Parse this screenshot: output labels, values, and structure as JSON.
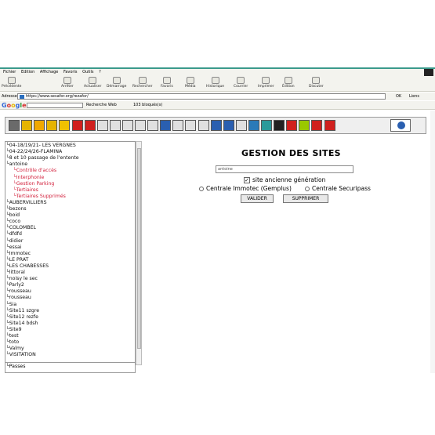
{
  "menu": [
    "Fichier",
    "Edition",
    "Affichage",
    "Favoris",
    "Outils",
    "?"
  ],
  "toolbar": {
    "buttons": [
      "Précédente",
      "Arrêter",
      "Actualiser",
      "Démarrage",
      "Rechercher",
      "Favoris",
      "Média",
      "Historique",
      "Courrier",
      "Imprimer",
      "Édition",
      "Discuter"
    ]
  },
  "address": {
    "label": "Adresse",
    "url": "https://www.sesafor.org/rezafor/",
    "go": "OK",
    "links": "Liens"
  },
  "google_bar": {
    "logo": "Google",
    "search_web": "Recherche Web",
    "blocked": "103 bloqués(s)"
  },
  "app_toolbar": {
    "icon_colors": [
      "#6a6a6a",
      "#e6b400",
      "#f0a800",
      "#e6b400",
      "#f0c000",
      "#d0201e",
      "#d0201e",
      "#e0e0e0",
      "#e0e0e0",
      "#e0e0e0",
      "#e0e0e0",
      "#e0e0e0",
      "#2a5fb0",
      "#e0e0e0",
      "#e0e0e0",
      "#e0e0e0",
      "#2a5fb0",
      "#2a5fb0",
      "#e0e0e0",
      "#2a7ab8",
      "#2a9a9a",
      "#222222",
      "#d0201e",
      "#9ac800",
      "#d0201e",
      "#d0201e"
    ]
  },
  "tree": {
    "items": [
      {
        "label": "04-18/19/21- LES VERGNES",
        "child": false
      },
      {
        "label": "04-22/24/26-FLAMINA",
        "child": false
      },
      {
        "label": "8 et 10 passage de l'entente",
        "child": false
      },
      {
        "label": "antoine",
        "child": false
      },
      {
        "label": "Contrôle d'accès",
        "child": true
      },
      {
        "label": "Interphonie",
        "child": true
      },
      {
        "label": "Gestion Parking",
        "child": true
      },
      {
        "label": "Tertiaires",
        "child": true
      },
      {
        "label": "Tertiaires Supprimés",
        "child": true
      },
      {
        "label": "AUBERVILLIERS",
        "child": false
      },
      {
        "label": "bezons",
        "child": false
      },
      {
        "label": "boid",
        "child": false
      },
      {
        "label": "coco",
        "child": false
      },
      {
        "label": "COLOMBEL",
        "child": false
      },
      {
        "label": "dfdfd",
        "child": false
      },
      {
        "label": "didier",
        "child": false
      },
      {
        "label": "essai",
        "child": false
      },
      {
        "label": "Immotec",
        "child": false
      },
      {
        "label": "LE PRAT",
        "child": false
      },
      {
        "label": "LES CHABESSES",
        "child": false
      },
      {
        "label": "littoral",
        "child": false
      },
      {
        "label": "noisy le sec",
        "child": false
      },
      {
        "label": "Parly2",
        "child": false
      },
      {
        "label": "rousseau",
        "child": false
      },
      {
        "label": "rousseau",
        "child": false
      },
      {
        "label": "Sia",
        "child": false
      },
      {
        "label": "Site11 szgre",
        "child": false
      },
      {
        "label": "Site12 rezfe",
        "child": false
      },
      {
        "label": "Site14 bdsh",
        "child": false
      },
      {
        "label": "Site9",
        "child": false
      },
      {
        "label": "test",
        "child": false
      },
      {
        "label": "toto",
        "child": false
      },
      {
        "label": "Valmy",
        "child": false
      },
      {
        "label": "VISITATION",
        "child": false
      }
    ],
    "lower": "Passes"
  },
  "main": {
    "title": "GESTION DES SITES",
    "site_value": "antoine",
    "checkbox_label": "site ancienne génération",
    "checkbox_mark": "✓",
    "radio1": "Centrale Immotec (Gemplus)",
    "radio2": "Centrale Securipass",
    "valider": "VALIDER",
    "supprimer": "SUPPRIMER"
  }
}
